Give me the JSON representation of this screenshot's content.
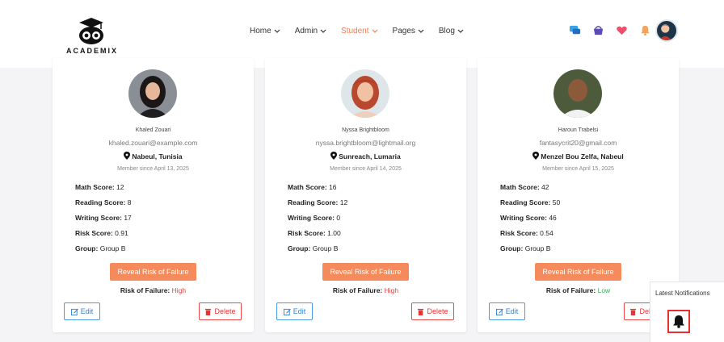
{
  "brand": {
    "name": "ACADEMIX"
  },
  "nav": [
    {
      "label": "Home",
      "active": false
    },
    {
      "label": "Admin",
      "active": false
    },
    {
      "label": "Student",
      "active": true
    },
    {
      "label": "Pages",
      "active": false
    },
    {
      "label": "Blog",
      "active": false
    }
  ],
  "header_icons": [
    "chat-icon",
    "basket-icon",
    "heart-icon",
    "bell-icon"
  ],
  "labels": {
    "math": "Math Score:",
    "reading": "Reading Score:",
    "writing": "Writing Score:",
    "risk_score": "Risk Score:",
    "group": "Group:",
    "reveal_button": "Reveal Risk of Failure",
    "risk_of_failure": "Risk of Failure:",
    "edit": "Edit",
    "delete": "Delete"
  },
  "students": [
    {
      "name": "Khaled Zouari",
      "email": "khaled.zouari@example.com",
      "location": "Nabeul, Tunisia",
      "member_since": "Member since April 13, 2025",
      "math": "12",
      "reading": "8",
      "writing": "17",
      "risk_score": "0.91",
      "group": "Group B",
      "risk": "High"
    },
    {
      "name": "Nyssa Brightbloom",
      "email": "nyssa.brightbloom@lightmail.org",
      "location": "Sunreach, Lumaria",
      "member_since": "Member since April 14, 2025",
      "math": "16",
      "reading": "12",
      "writing": "0",
      "risk_score": "1.00",
      "group": "Group B",
      "risk": "High"
    },
    {
      "name": "Haroun Trabelsi",
      "email": "fantasycrit20@gmail.com",
      "location": "Menzel Bou Zelfa, Nabeul",
      "member_since": "Member since April 15, 2025",
      "math": "42",
      "reading": "50",
      "writing": "46",
      "risk_score": "0.54",
      "group": "Group B",
      "risk": "Low"
    }
  ],
  "colors": {
    "accent": "#f58a5d",
    "high": "#e83e3e",
    "low": "#2cb35a",
    "edit": "#2f80d4",
    "delete": "#e83333"
  },
  "notifications": {
    "title": "Latest Notifications"
  }
}
